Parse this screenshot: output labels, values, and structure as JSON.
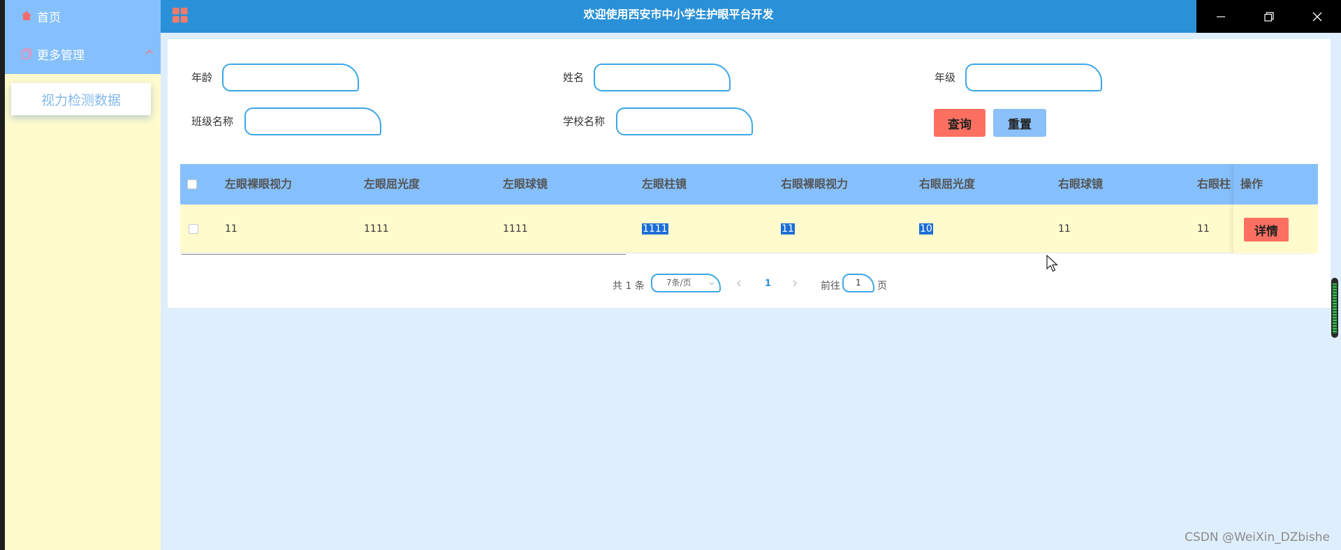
{
  "window": {
    "title": "欢迎使用西安市中小学生护眼平台开发"
  },
  "sidebar": {
    "home_label": "首页",
    "more_label": "更多管理",
    "sub_item_label": "视力检测数据"
  },
  "search": {
    "age_label": "年龄",
    "name_label": "姓名",
    "grade_label": "年级",
    "class_label": "班级名称",
    "school_label": "学校名称",
    "age_value": "",
    "name_value": "",
    "grade_value": "",
    "class_value": "",
    "school_value": "",
    "query_label": "查询",
    "reset_label": "重置"
  },
  "table": {
    "columns": [
      "左眼裸眼视力",
      "左眼屈光度",
      "左眼球镜",
      "左眼柱镜",
      "右眼裸眼视力",
      "右眼屈光度",
      "右眼球镜",
      "右眼柱"
    ],
    "action_header": "操作",
    "rows": [
      {
        "cells": [
          "11",
          "1111",
          "1111",
          "1111",
          "11",
          "10",
          "11",
          "11"
        ],
        "detail_label": "详情"
      }
    ]
  },
  "pagination": {
    "total_text": "共 1 条",
    "page_size": "7条/页",
    "current_page": "1",
    "goto_prefix": "前往",
    "goto_value": "1",
    "goto_suffix": "页"
  },
  "watermark": "CSDN @WeiXin_DZbishe",
  "colors": {
    "sidebar_bg": "#fffbcd",
    "menu_bg": "#85c0fc",
    "header_bg": "#2a90d8",
    "table_header_bg": "#86c0fc",
    "danger_btn": "#fd6f61",
    "reset_btn": "#8bc1fa",
    "input_border": "#3aa7e6"
  }
}
